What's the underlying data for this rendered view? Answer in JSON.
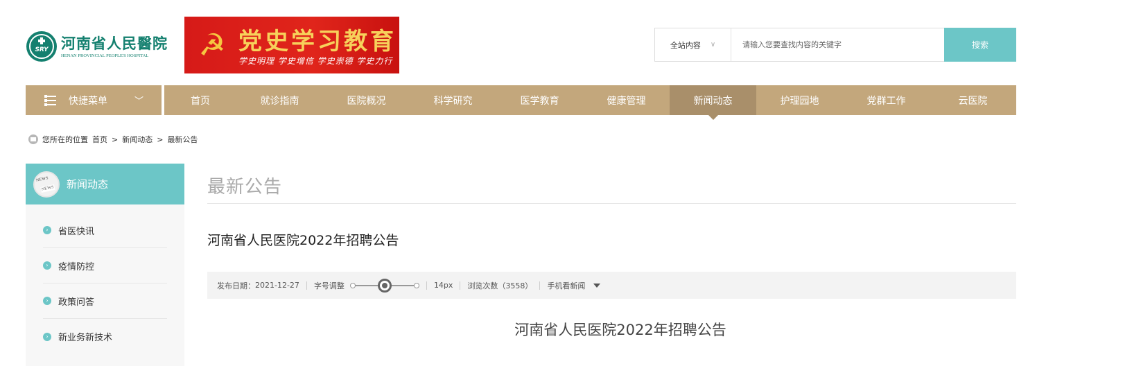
{
  "logo": {
    "cn": "河南省人民醫院",
    "en": "HENAN PROVINCIAL PEOPLE'S HOSPITAL",
    "mark": "SRY"
  },
  "banner": {
    "title": "党史学习教育",
    "subtitle": "学史明理 学史增信 学史崇德 学史力行"
  },
  "search": {
    "scope": "全站内容",
    "placeholder": "请输入您要查找内容的关键字",
    "button": "搜索"
  },
  "quick_menu": {
    "label": "快捷菜单"
  },
  "nav": {
    "items": [
      "首页",
      "就诊指南",
      "医院概况",
      "科学研究",
      "医学教育",
      "健康管理",
      "新闻动态",
      "护理园地",
      "党群工作",
      "云医院"
    ],
    "active": "新闻动态"
  },
  "breadcrumb": {
    "prefix": "您所在的位置",
    "items": [
      "首页",
      ">",
      "新闻动态",
      ">",
      "最新公告"
    ]
  },
  "sidebar": {
    "title": "新闻动态",
    "items": [
      "省医快讯",
      "疫情防控",
      "政策问答",
      "新业务新技术"
    ]
  },
  "main": {
    "section_title": "最新公告",
    "article_title": "河南省人民医院2022年招聘公告",
    "meta": {
      "publish_label": "发布日期：",
      "publish_date": "2021-12-27",
      "font_adjust": "字号调整",
      "font_size": "14px",
      "views": "浏览次数（3558）",
      "mobile": "手机看新闻"
    },
    "article_heading": "河南省人民医院2022年招聘公告"
  },
  "font_slider": {
    "fraction": 0.5
  },
  "colors": {
    "accent": "#6cc6c7",
    "nav": "#c3a77c",
    "nav_active": "#a98f6a",
    "brand": "#14806f",
    "banner_red": "#d61a18"
  }
}
